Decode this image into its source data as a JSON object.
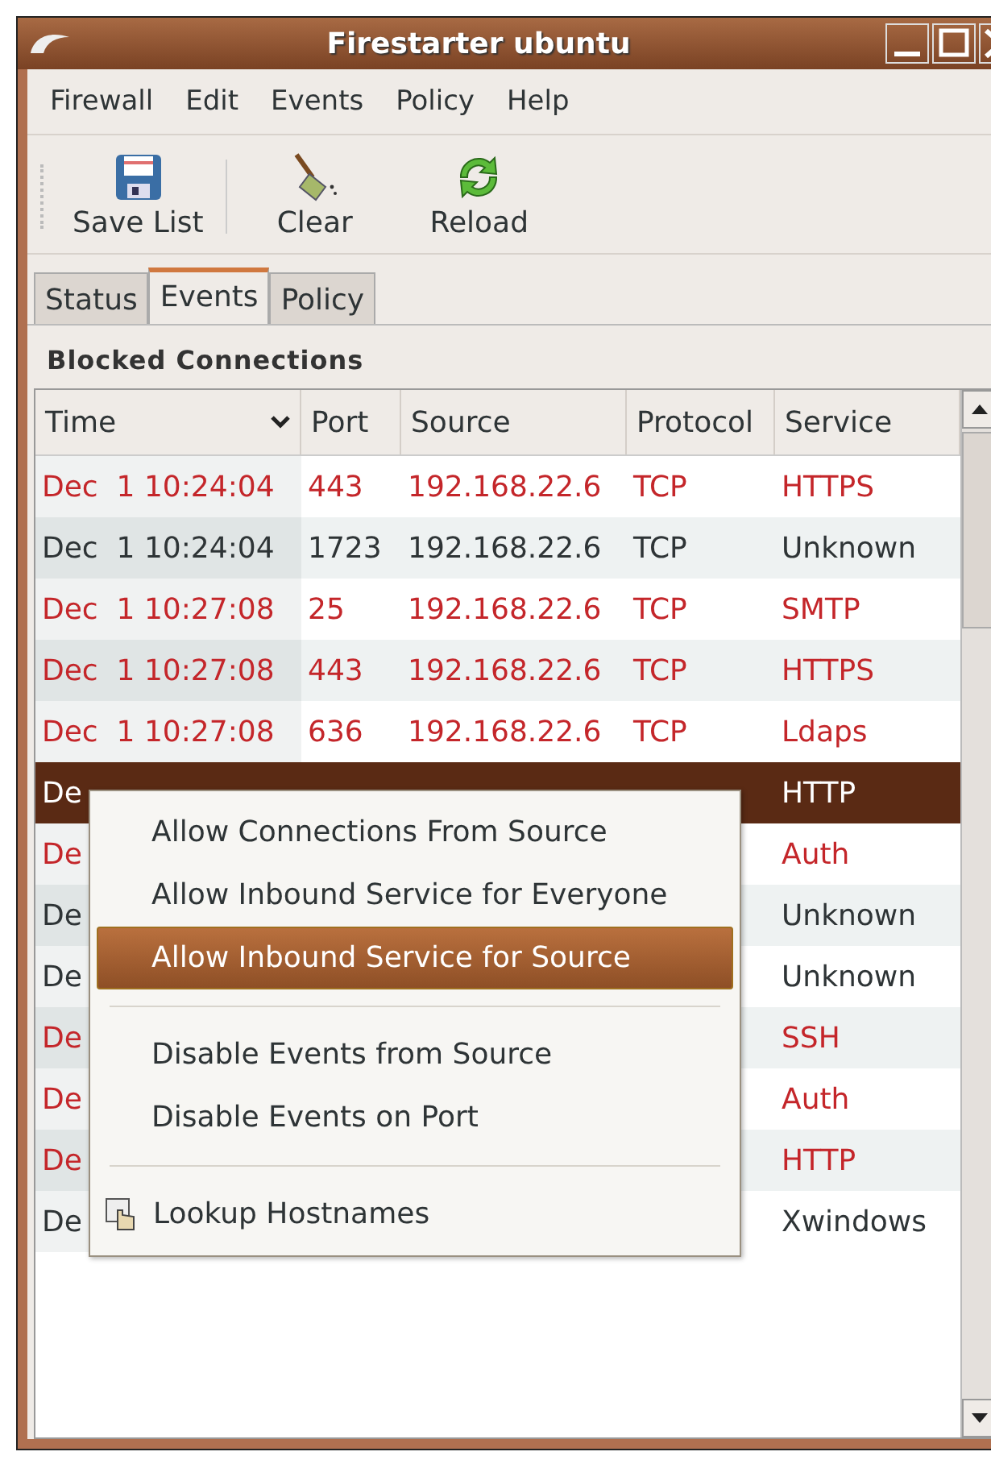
{
  "window": {
    "title": "Firestarter ubuntu"
  },
  "menu_bar": [
    {
      "label": "Firewall"
    },
    {
      "label": "Edit"
    },
    {
      "label": "Events"
    },
    {
      "label": "Policy"
    },
    {
      "label": "Help"
    }
  ],
  "toolbar": [
    {
      "kind": "save",
      "label": "Save List"
    },
    {
      "kind": "clear",
      "label": "Clear"
    },
    {
      "kind": "reload",
      "label": "Reload"
    }
  ],
  "tabs": [
    {
      "label": "Status",
      "selected": false
    },
    {
      "label": "Events",
      "selected": true
    },
    {
      "label": "Policy",
      "selected": false
    }
  ],
  "section_title": "Blocked Connections",
  "table": {
    "columns": [
      "Time",
      "Port",
      "Source",
      "Protocol",
      "Service"
    ],
    "rows": [
      {
        "color": "#c4262a",
        "selected": false,
        "cells": [
          "Dec  1 10:24:04",
          "443",
          "192.168.22.6",
          "TCP",
          "HTTPS"
        ]
      },
      {
        "color": "#2e3436",
        "selected": false,
        "cells": [
          "Dec  1 10:24:04",
          "1723",
          "192.168.22.6",
          "TCP",
          "Unknown"
        ]
      },
      {
        "color": "#c4262a",
        "selected": false,
        "cells": [
          "Dec  1 10:27:08",
          "25",
          "192.168.22.6",
          "TCP",
          "SMTP"
        ]
      },
      {
        "color": "#c4262a",
        "selected": false,
        "cells": [
          "Dec  1 10:27:08",
          "443",
          "192.168.22.6",
          "TCP",
          "HTTPS"
        ]
      },
      {
        "color": "#c4262a",
        "selected": false,
        "cells": [
          "Dec  1 10:27:08",
          "636",
          "192.168.22.6",
          "TCP",
          "Ldaps"
        ]
      },
      {
        "selected": true,
        "cells": [
          "De",
          null,
          null,
          null,
          "HTTP"
        ]
      },
      {
        "color": "#c4262a",
        "selected": false,
        "cells": [
          "De",
          null,
          null,
          null,
          "Auth"
        ]
      },
      {
        "color": "#2e3436",
        "selected": false,
        "cells": [
          "De",
          null,
          null,
          null,
          "Unknown"
        ]
      },
      {
        "color": "#2e3436",
        "selected": false,
        "cells": [
          "De",
          null,
          null,
          null,
          "Unknown"
        ]
      },
      {
        "color": "#c4262a",
        "selected": false,
        "cells": [
          "De",
          null,
          null,
          null,
          "SSH"
        ]
      },
      {
        "color": "#c4262a",
        "selected": false,
        "cells": [
          "De",
          null,
          null,
          null,
          "Auth"
        ]
      },
      {
        "color": "#c4262a",
        "selected": false,
        "cells": [
          "De",
          null,
          null,
          null,
          "HTTP"
        ]
      },
      {
        "color": "#2e3436",
        "selected": false,
        "cells": [
          "De",
          null,
          null,
          null,
          "Xwindows"
        ]
      }
    ]
  },
  "context_menu": [
    {
      "kind": "item",
      "label": "Allow Connections From Source",
      "selected": false
    },
    {
      "kind": "item",
      "label": "Allow Inbound Service for Everyone",
      "selected": false
    },
    {
      "kind": "item",
      "label": "Allow Inbound Service for Source",
      "selected": true
    },
    {
      "kind": "separator"
    },
    {
      "kind": "item",
      "label": "Disable Events from Source",
      "selected": false
    },
    {
      "kind": "item",
      "label": "Disable Events on Port",
      "selected": false
    },
    {
      "kind": "separator"
    },
    {
      "kind": "icon_item",
      "label": "Lookup Hostnames",
      "selected": false
    }
  ]
}
